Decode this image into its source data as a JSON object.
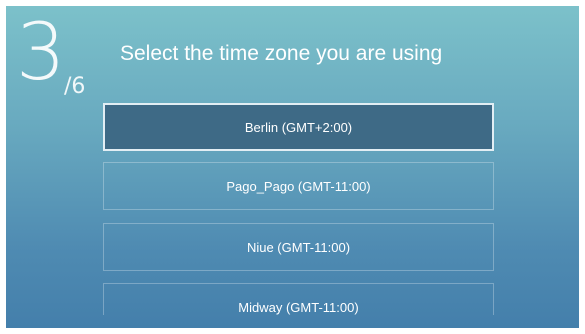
{
  "wizard": {
    "step_current": "3",
    "step_total": "/6",
    "title": "Select the time zone you are using"
  },
  "timezones": [
    {
      "label": "Berlin  (GMT+2:00)",
      "selected": true
    },
    {
      "label": "Pago_Pago  (GMT-11:00)",
      "selected": false
    },
    {
      "label": "Niue  (GMT-11:00)",
      "selected": false
    },
    {
      "label": "Midway  (GMT-11:00)",
      "selected": false
    }
  ]
}
